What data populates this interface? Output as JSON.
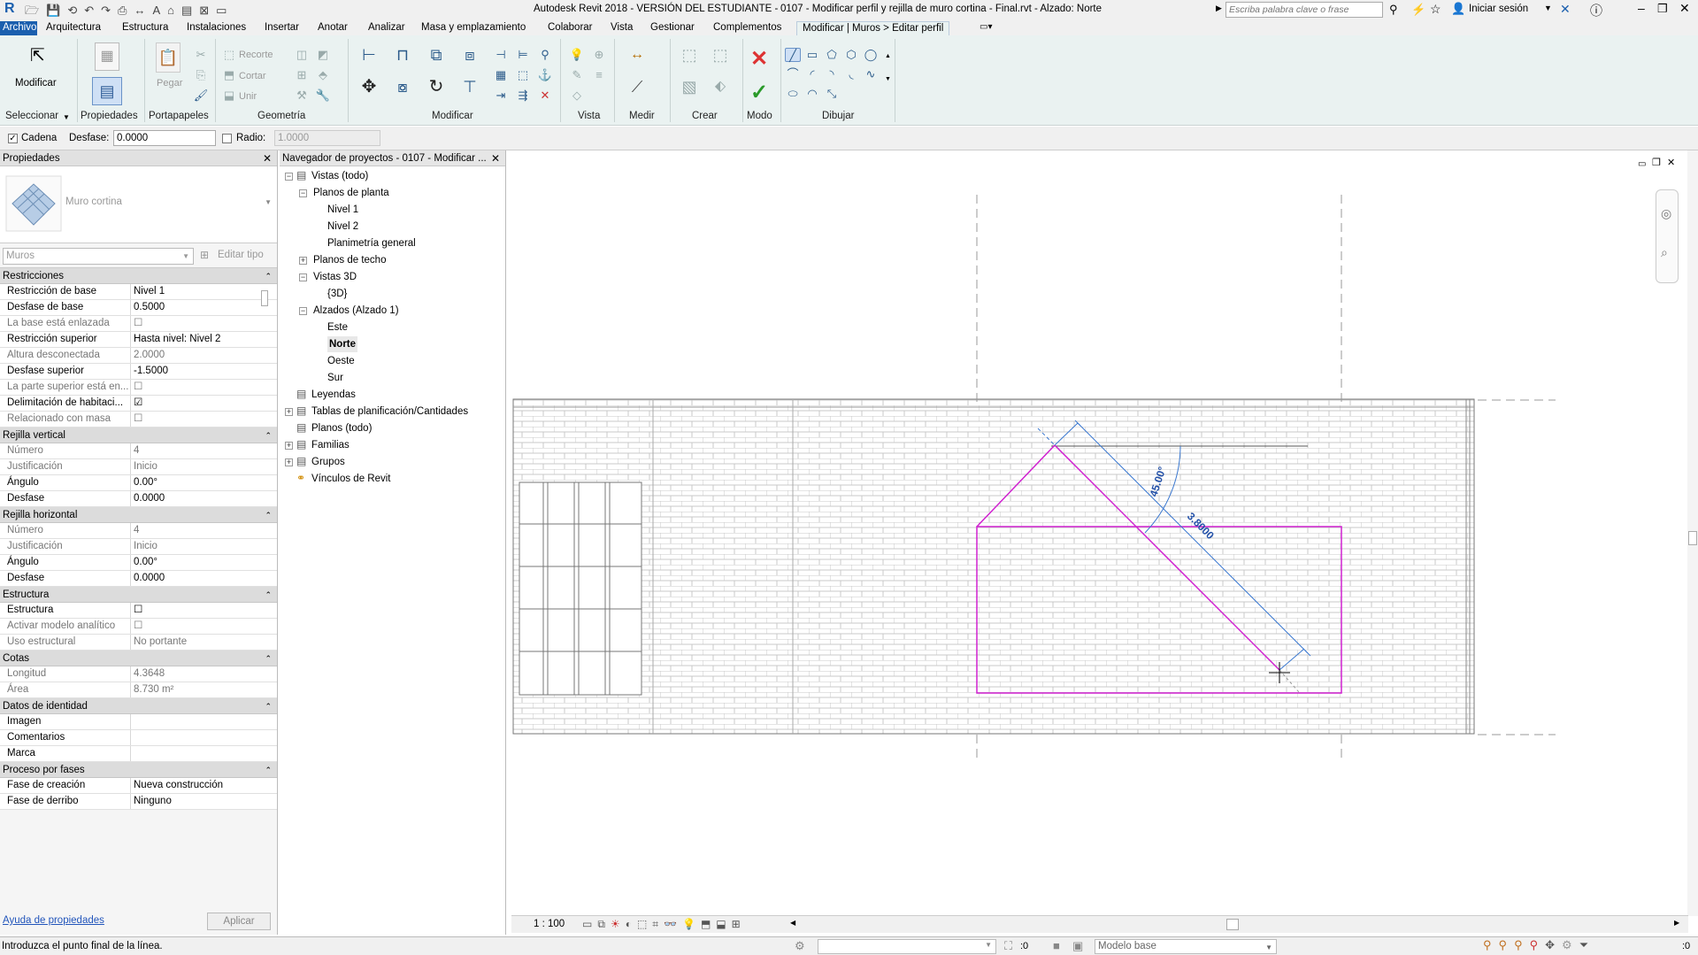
{
  "title": {
    "app": "Autodesk Revit 2018 - VERSIÓN DEL ESTUDIANTE -",
    "file": "0107 - Modificar perfil y rejilla de muro cortina - Final.rvt - Alzado: Norte",
    "search_placeholder": "Escriba palabra clave o frase",
    "signin": "Iniciar sesión"
  },
  "ribbon_tabs": [
    "Archivo",
    "Arquitectura",
    "Estructura",
    "Instalaciones",
    "Insertar",
    "Anotar",
    "Analizar",
    "Masa y emplazamiento",
    "Colaborar",
    "Vista",
    "Gestionar",
    "Complementos",
    "Modificar | Muros > Editar perfil"
  ],
  "ribbon": {
    "modify": "Modificar",
    "select": "Seleccionar",
    "properties": "Propiedades",
    "clipboard": "Portapapeles",
    "paste": "Pegar",
    "geometry": "Geometría",
    "cope": "Recorte",
    "cut": "Cortar",
    "join": "Unir",
    "modify_panel": "Modificar",
    "view": "Vista",
    "measure": "Medir",
    "create": "Crear",
    "mode": "Modo",
    "draw": "Dibujar"
  },
  "options": {
    "chain_label": "Cadena",
    "chain_checked": true,
    "offset_label": "Desfase:",
    "offset_value": "0.0000",
    "radius_label": "Radio:",
    "radius_checked": false,
    "radius_value": "1.0000"
  },
  "properties": {
    "title": "Propiedades",
    "type_name": "Muro cortina",
    "filter": "Muros",
    "edit_type": "Editar tipo",
    "sections": [
      {
        "name": "Restricciones",
        "rows": [
          {
            "k": "Restricción de base",
            "v": "Nivel 1",
            "dim": false
          },
          {
            "k": "Desfase de base",
            "v": "0.5000",
            "dim": false
          },
          {
            "k": "La base está enlazada",
            "v": "☐",
            "dim": true
          },
          {
            "k": "Restricción superior",
            "v": "Hasta nivel: Nivel 2",
            "dim": false
          },
          {
            "k": "Altura desconectada",
            "v": "2.0000",
            "dim": true
          },
          {
            "k": "Desfase superior",
            "v": "-1.5000",
            "dim": false
          },
          {
            "k": "La parte superior está en...",
            "v": "☐",
            "dim": true
          },
          {
            "k": "Delimitación de habitaci...",
            "v": "☑",
            "dim": false
          },
          {
            "k": "Relacionado con masa",
            "v": "☐",
            "dim": true
          }
        ]
      },
      {
        "name": "Rejilla vertical",
        "rows": [
          {
            "k": "Número",
            "v": "4",
            "dim": true
          },
          {
            "k": "Justificación",
            "v": "Inicio",
            "dim": true
          },
          {
            "k": "Ángulo",
            "v": "0.00°",
            "dim": false
          },
          {
            "k": "Desfase",
            "v": "0.0000",
            "dim": false
          }
        ]
      },
      {
        "name": "Rejilla horizontal",
        "rows": [
          {
            "k": "Número",
            "v": "4",
            "dim": true
          },
          {
            "k": "Justificación",
            "v": "Inicio",
            "dim": true
          },
          {
            "k": "Ángulo",
            "v": "0.00°",
            "dim": false
          },
          {
            "k": "Desfase",
            "v": "0.0000",
            "dim": false
          }
        ]
      },
      {
        "name": "Estructura",
        "rows": [
          {
            "k": "Estructura",
            "v": "☐",
            "dim": false
          },
          {
            "k": "Activar modelo analítico",
            "v": "☐",
            "dim": true
          },
          {
            "k": "Uso estructural",
            "v": "No portante",
            "dim": true
          }
        ]
      },
      {
        "name": "Cotas",
        "rows": [
          {
            "k": "Longitud",
            "v": "4.3648",
            "dim": true
          },
          {
            "k": "Área",
            "v": "8.730 m²",
            "dim": true
          }
        ]
      },
      {
        "name": "Datos de identidad",
        "rows": [
          {
            "k": "Imagen",
            "v": "",
            "dim": false
          },
          {
            "k": "Comentarios",
            "v": "",
            "dim": false
          },
          {
            "k": "Marca",
            "v": "",
            "dim": false
          }
        ]
      },
      {
        "name": "Proceso por fases",
        "rows": [
          {
            "k": "Fase de creación",
            "v": "Nueva construcción",
            "dim": false
          },
          {
            "k": "Fase de derribo",
            "v": "Ninguno",
            "dim": false
          }
        ]
      }
    ],
    "help_link": "Ayuda de propiedades",
    "apply": "Aplicar"
  },
  "browser": {
    "title": "Navegador de proyectos - 0107 - Modificar ...",
    "items": [
      {
        "label": "Vistas (todo)",
        "level": 0,
        "exp": "-",
        "icon": true,
        "bold": false
      },
      {
        "label": "Planos de planta",
        "level": 1,
        "exp": "-",
        "icon": false,
        "bold": false
      },
      {
        "label": "Nivel 1",
        "level": 2,
        "exp": "",
        "icon": false,
        "bold": false
      },
      {
        "label": "Nivel 2",
        "level": 2,
        "exp": "",
        "icon": false,
        "bold": false
      },
      {
        "label": "Planimetría general",
        "level": 2,
        "exp": "",
        "icon": false,
        "bold": false
      },
      {
        "label": "Planos de techo",
        "level": 1,
        "exp": "+",
        "icon": false,
        "bold": false
      },
      {
        "label": "Vistas 3D",
        "level": 1,
        "exp": "-",
        "icon": false,
        "bold": false
      },
      {
        "label": "{3D}",
        "level": 2,
        "exp": "",
        "icon": false,
        "bold": false
      },
      {
        "label": "Alzados (Alzado 1)",
        "level": 1,
        "exp": "-",
        "icon": false,
        "bold": false
      },
      {
        "label": "Este",
        "level": 2,
        "exp": "",
        "icon": false,
        "bold": false
      },
      {
        "label": "Norte",
        "level": 2,
        "exp": "",
        "icon": false,
        "bold": true
      },
      {
        "label": "Oeste",
        "level": 2,
        "exp": "",
        "icon": false,
        "bold": false
      },
      {
        "label": "Sur",
        "level": 2,
        "exp": "",
        "icon": false,
        "bold": false
      },
      {
        "label": "Leyendas",
        "level": 0,
        "exp": "",
        "icon": true,
        "bold": false
      },
      {
        "label": "Tablas de planificación/Cantidades",
        "level": 0,
        "exp": "+",
        "icon": true,
        "bold": false
      },
      {
        "label": "Planos (todo)",
        "level": 0,
        "exp": "",
        "icon": true,
        "bold": false
      },
      {
        "label": "Familias",
        "level": 0,
        "exp": "+",
        "icon": true,
        "bold": false
      },
      {
        "label": "Grupos",
        "level": 0,
        "exp": "+",
        "icon": true,
        "bold": false
      },
      {
        "label": "Vínculos de Revit",
        "level": 0,
        "exp": "",
        "icon": true,
        "bold": false
      }
    ]
  },
  "canvas": {
    "angle_label": "45.00°",
    "length_label": "3.8000",
    "scale": "1 : 100"
  },
  "status": {
    "message": "Introduzca el punto final de la línea.",
    "zero": ":0",
    "model": "Modelo base",
    "filter_count": ":0"
  },
  "colors": {
    "profile": "#d020d0",
    "dimension": "#3a78d0",
    "brick": "#c9c9c9",
    "ribbon_bg": "#eaf2f1"
  }
}
